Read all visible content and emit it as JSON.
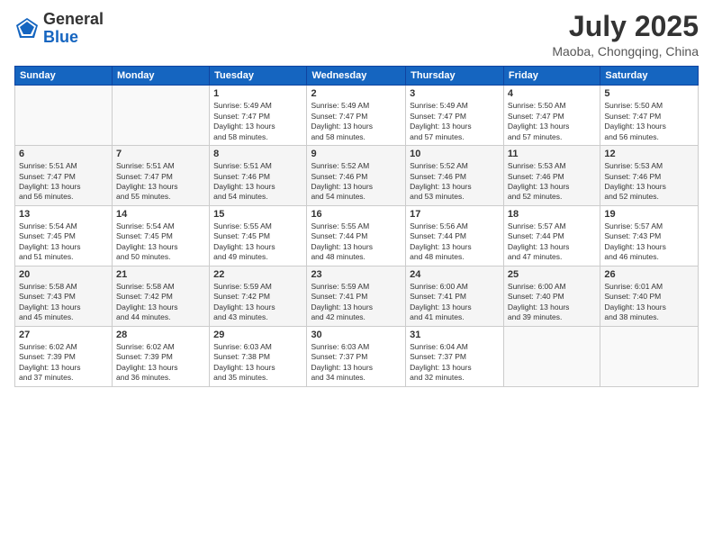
{
  "logo": {
    "general": "General",
    "blue": "Blue"
  },
  "title": {
    "month_year": "July 2025",
    "location": "Maoba, Chongqing, China"
  },
  "weekdays": [
    "Sunday",
    "Monday",
    "Tuesday",
    "Wednesday",
    "Thursday",
    "Friday",
    "Saturday"
  ],
  "weeks": [
    [
      {
        "day": "",
        "info": ""
      },
      {
        "day": "",
        "info": ""
      },
      {
        "day": "1",
        "info": "Sunrise: 5:49 AM\nSunset: 7:47 PM\nDaylight: 13 hours\nand 58 minutes."
      },
      {
        "day": "2",
        "info": "Sunrise: 5:49 AM\nSunset: 7:47 PM\nDaylight: 13 hours\nand 58 minutes."
      },
      {
        "day": "3",
        "info": "Sunrise: 5:49 AM\nSunset: 7:47 PM\nDaylight: 13 hours\nand 57 minutes."
      },
      {
        "day": "4",
        "info": "Sunrise: 5:50 AM\nSunset: 7:47 PM\nDaylight: 13 hours\nand 57 minutes."
      },
      {
        "day": "5",
        "info": "Sunrise: 5:50 AM\nSunset: 7:47 PM\nDaylight: 13 hours\nand 56 minutes."
      }
    ],
    [
      {
        "day": "6",
        "info": "Sunrise: 5:51 AM\nSunset: 7:47 PM\nDaylight: 13 hours\nand 56 minutes."
      },
      {
        "day": "7",
        "info": "Sunrise: 5:51 AM\nSunset: 7:47 PM\nDaylight: 13 hours\nand 55 minutes."
      },
      {
        "day": "8",
        "info": "Sunrise: 5:51 AM\nSunset: 7:46 PM\nDaylight: 13 hours\nand 54 minutes."
      },
      {
        "day": "9",
        "info": "Sunrise: 5:52 AM\nSunset: 7:46 PM\nDaylight: 13 hours\nand 54 minutes."
      },
      {
        "day": "10",
        "info": "Sunrise: 5:52 AM\nSunset: 7:46 PM\nDaylight: 13 hours\nand 53 minutes."
      },
      {
        "day": "11",
        "info": "Sunrise: 5:53 AM\nSunset: 7:46 PM\nDaylight: 13 hours\nand 52 minutes."
      },
      {
        "day": "12",
        "info": "Sunrise: 5:53 AM\nSunset: 7:46 PM\nDaylight: 13 hours\nand 52 minutes."
      }
    ],
    [
      {
        "day": "13",
        "info": "Sunrise: 5:54 AM\nSunset: 7:45 PM\nDaylight: 13 hours\nand 51 minutes."
      },
      {
        "day": "14",
        "info": "Sunrise: 5:54 AM\nSunset: 7:45 PM\nDaylight: 13 hours\nand 50 minutes."
      },
      {
        "day": "15",
        "info": "Sunrise: 5:55 AM\nSunset: 7:45 PM\nDaylight: 13 hours\nand 49 minutes."
      },
      {
        "day": "16",
        "info": "Sunrise: 5:55 AM\nSunset: 7:44 PM\nDaylight: 13 hours\nand 48 minutes."
      },
      {
        "day": "17",
        "info": "Sunrise: 5:56 AM\nSunset: 7:44 PM\nDaylight: 13 hours\nand 48 minutes."
      },
      {
        "day": "18",
        "info": "Sunrise: 5:57 AM\nSunset: 7:44 PM\nDaylight: 13 hours\nand 47 minutes."
      },
      {
        "day": "19",
        "info": "Sunrise: 5:57 AM\nSunset: 7:43 PM\nDaylight: 13 hours\nand 46 minutes."
      }
    ],
    [
      {
        "day": "20",
        "info": "Sunrise: 5:58 AM\nSunset: 7:43 PM\nDaylight: 13 hours\nand 45 minutes."
      },
      {
        "day": "21",
        "info": "Sunrise: 5:58 AM\nSunset: 7:42 PM\nDaylight: 13 hours\nand 44 minutes."
      },
      {
        "day": "22",
        "info": "Sunrise: 5:59 AM\nSunset: 7:42 PM\nDaylight: 13 hours\nand 43 minutes."
      },
      {
        "day": "23",
        "info": "Sunrise: 5:59 AM\nSunset: 7:41 PM\nDaylight: 13 hours\nand 42 minutes."
      },
      {
        "day": "24",
        "info": "Sunrise: 6:00 AM\nSunset: 7:41 PM\nDaylight: 13 hours\nand 41 minutes."
      },
      {
        "day": "25",
        "info": "Sunrise: 6:00 AM\nSunset: 7:40 PM\nDaylight: 13 hours\nand 39 minutes."
      },
      {
        "day": "26",
        "info": "Sunrise: 6:01 AM\nSunset: 7:40 PM\nDaylight: 13 hours\nand 38 minutes."
      }
    ],
    [
      {
        "day": "27",
        "info": "Sunrise: 6:02 AM\nSunset: 7:39 PM\nDaylight: 13 hours\nand 37 minutes."
      },
      {
        "day": "28",
        "info": "Sunrise: 6:02 AM\nSunset: 7:39 PM\nDaylight: 13 hours\nand 36 minutes."
      },
      {
        "day": "29",
        "info": "Sunrise: 6:03 AM\nSunset: 7:38 PM\nDaylight: 13 hours\nand 35 minutes."
      },
      {
        "day": "30",
        "info": "Sunrise: 6:03 AM\nSunset: 7:37 PM\nDaylight: 13 hours\nand 34 minutes."
      },
      {
        "day": "31",
        "info": "Sunrise: 6:04 AM\nSunset: 7:37 PM\nDaylight: 13 hours\nand 32 minutes."
      },
      {
        "day": "",
        "info": ""
      },
      {
        "day": "",
        "info": ""
      }
    ]
  ]
}
